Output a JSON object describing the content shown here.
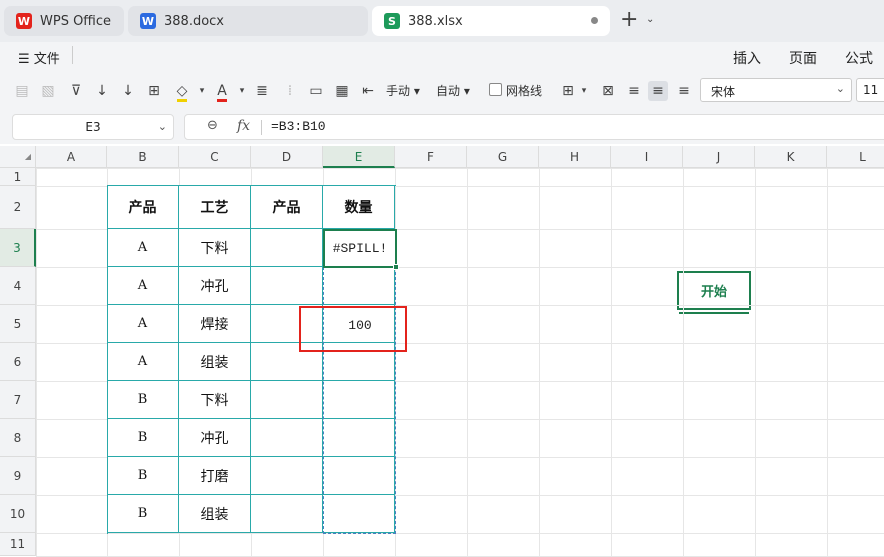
{
  "tabs": [
    {
      "label": "WPS Office",
      "badge": "W"
    },
    {
      "label": "388.docx",
      "badge": "W"
    },
    {
      "label": "388.xlsx",
      "badge": "S"
    }
  ],
  "menu": {
    "file": "文件",
    "ribbon_tabs": [
      "开始",
      "插入",
      "页面",
      "公式"
    ]
  },
  "toolbar": {
    "page_break_label": "手动",
    "auto_label": "自动",
    "gridlines_label": "网格线",
    "font_name": "宋体",
    "font_size": "11"
  },
  "formula_bar": {
    "name_box": "E3",
    "fx": "fx",
    "formula": "=B3:B10"
  },
  "columns": [
    "A",
    "B",
    "C",
    "D",
    "E",
    "F",
    "G",
    "H",
    "I",
    "J",
    "K",
    "L"
  ],
  "rows": [
    "1",
    "2",
    "3",
    "4",
    "5",
    "6",
    "7",
    "8",
    "9",
    "10",
    "11"
  ],
  "table": {
    "headers": [
      "产品",
      "工艺",
      "产品",
      "数量"
    ],
    "rows": [
      [
        "A",
        "下料",
        "",
        ""
      ],
      [
        "A",
        "冲孔",
        "",
        ""
      ],
      [
        "A",
        "焊接",
        "",
        ""
      ],
      [
        "A",
        "组装",
        "",
        ""
      ],
      [
        "B",
        "下料",
        "",
        ""
      ],
      [
        "B",
        "冲孔",
        "",
        ""
      ],
      [
        "B",
        "打磨",
        "",
        ""
      ],
      [
        "B",
        "组装",
        "",
        ""
      ]
    ]
  },
  "active_cell_value": "#SPILL!",
  "e5_value": "100",
  "colors": {
    "accent": "#1d7f4e",
    "table_border": "#29a9a9",
    "highlight": "#e3231c",
    "spill_border": "#4a7fc1"
  }
}
